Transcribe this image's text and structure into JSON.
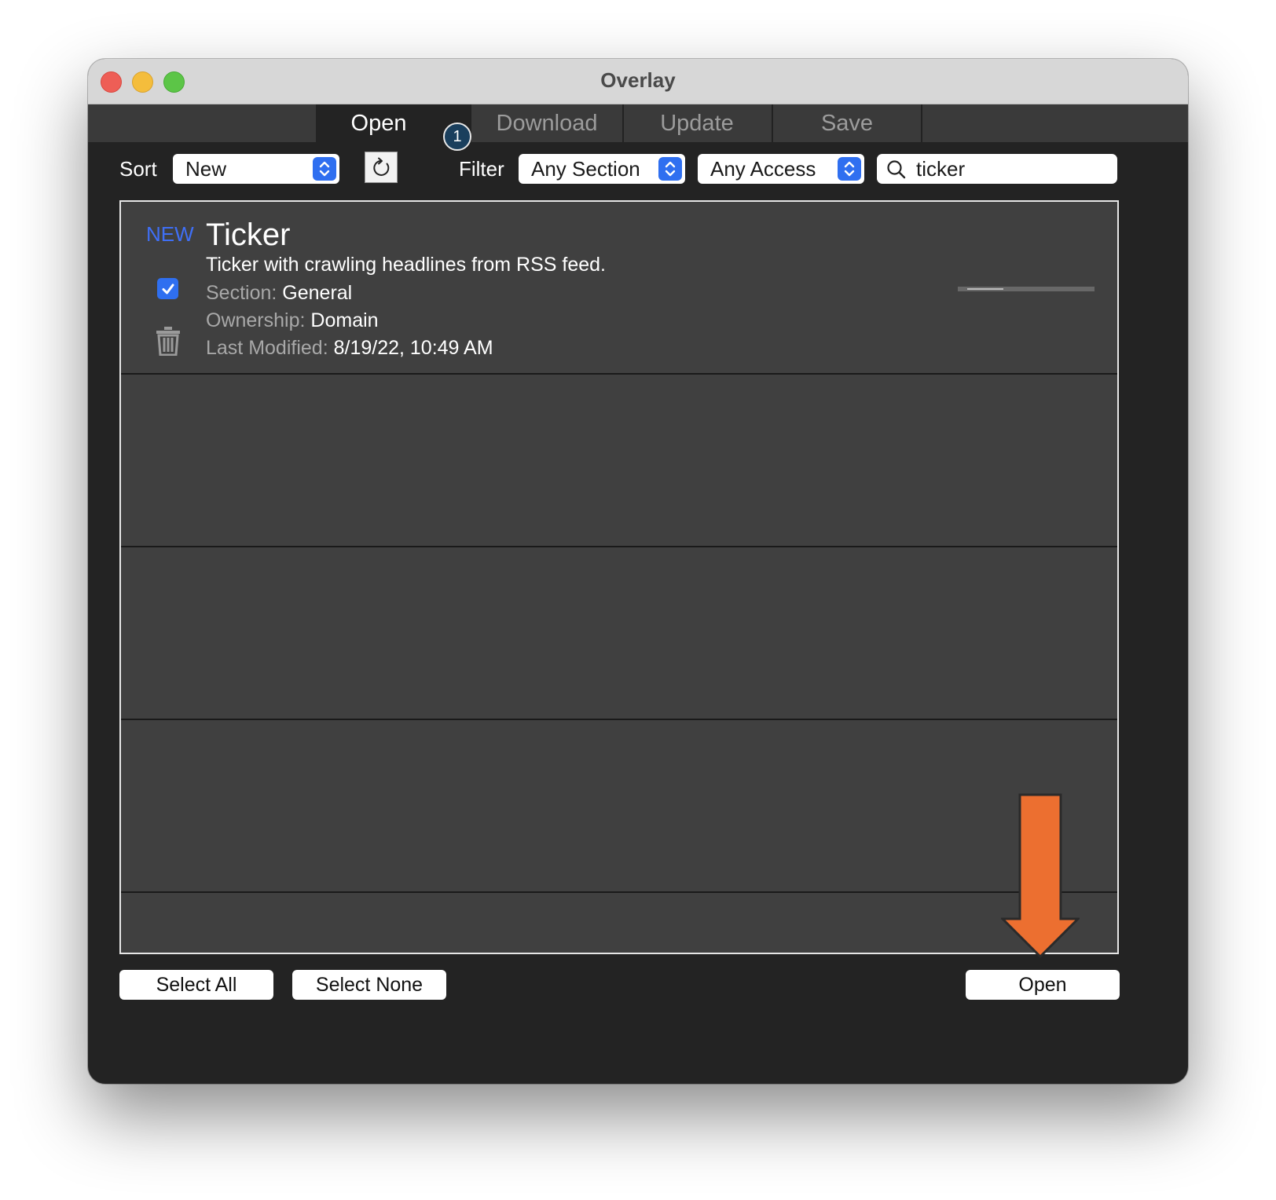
{
  "window": {
    "title": "Overlay"
  },
  "tabs": [
    {
      "label": "Open",
      "active": true
    },
    {
      "label": "Download",
      "active": false
    },
    {
      "label": "Update",
      "active": false
    },
    {
      "label": "Save",
      "active": false
    }
  ],
  "tab_badge": "1",
  "toolbar": {
    "sort_label": "Sort",
    "sort_value": "New",
    "filter_label": "Filter",
    "section_value": "Any Section",
    "access_value": "Any Access",
    "search_value": "ticker"
  },
  "item": {
    "badge": "NEW",
    "title": "Ticker",
    "description": "Ticker with crawling headlines from RSS feed.",
    "checked": true,
    "section_key": "Section:",
    "section_value": "General",
    "ownership_key": "Ownership:",
    "ownership_value": "Domain",
    "modified_key": "Last Modified:",
    "modified_value": "8/19/22, 10:49 AM"
  },
  "buttons": {
    "select_all": "Select All",
    "select_none": "Select None",
    "open": "Open"
  },
  "colors": {
    "accent_blue": "#2f6ff0",
    "new_badge": "#3f6ff5",
    "arrow": "#ec6f30"
  }
}
